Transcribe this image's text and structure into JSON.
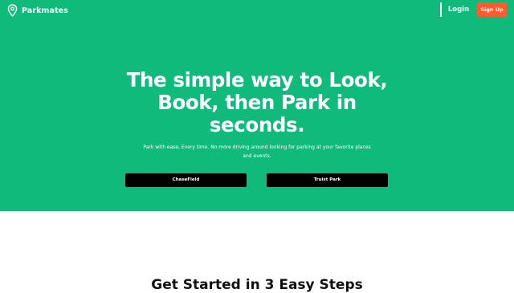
{
  "nav": {
    "brand": "Parkmates",
    "brand_icon": "map-pin-icon",
    "login_label": "Login",
    "signup_label": "Sign Up"
  },
  "hero": {
    "headline": {
      "part1": "The simple way to ",
      "bold1": "Look,",
      "bold2": "Book, then Park",
      "part2": " in",
      "part3": "seconds."
    },
    "tagline": "Park with ease, Every time. No more driving around looking for parking at your favorite places and events.",
    "locations": [
      "ChaseField",
      "Truist Park"
    ]
  },
  "steps": {
    "title": "Get Started in 3 Easy Steps"
  },
  "colors": {
    "hero_bg": "#0fba7b",
    "signup_bg": "#ff5b2e",
    "button_bg": "#000000",
    "text_on_hero": "#ffffff"
  }
}
